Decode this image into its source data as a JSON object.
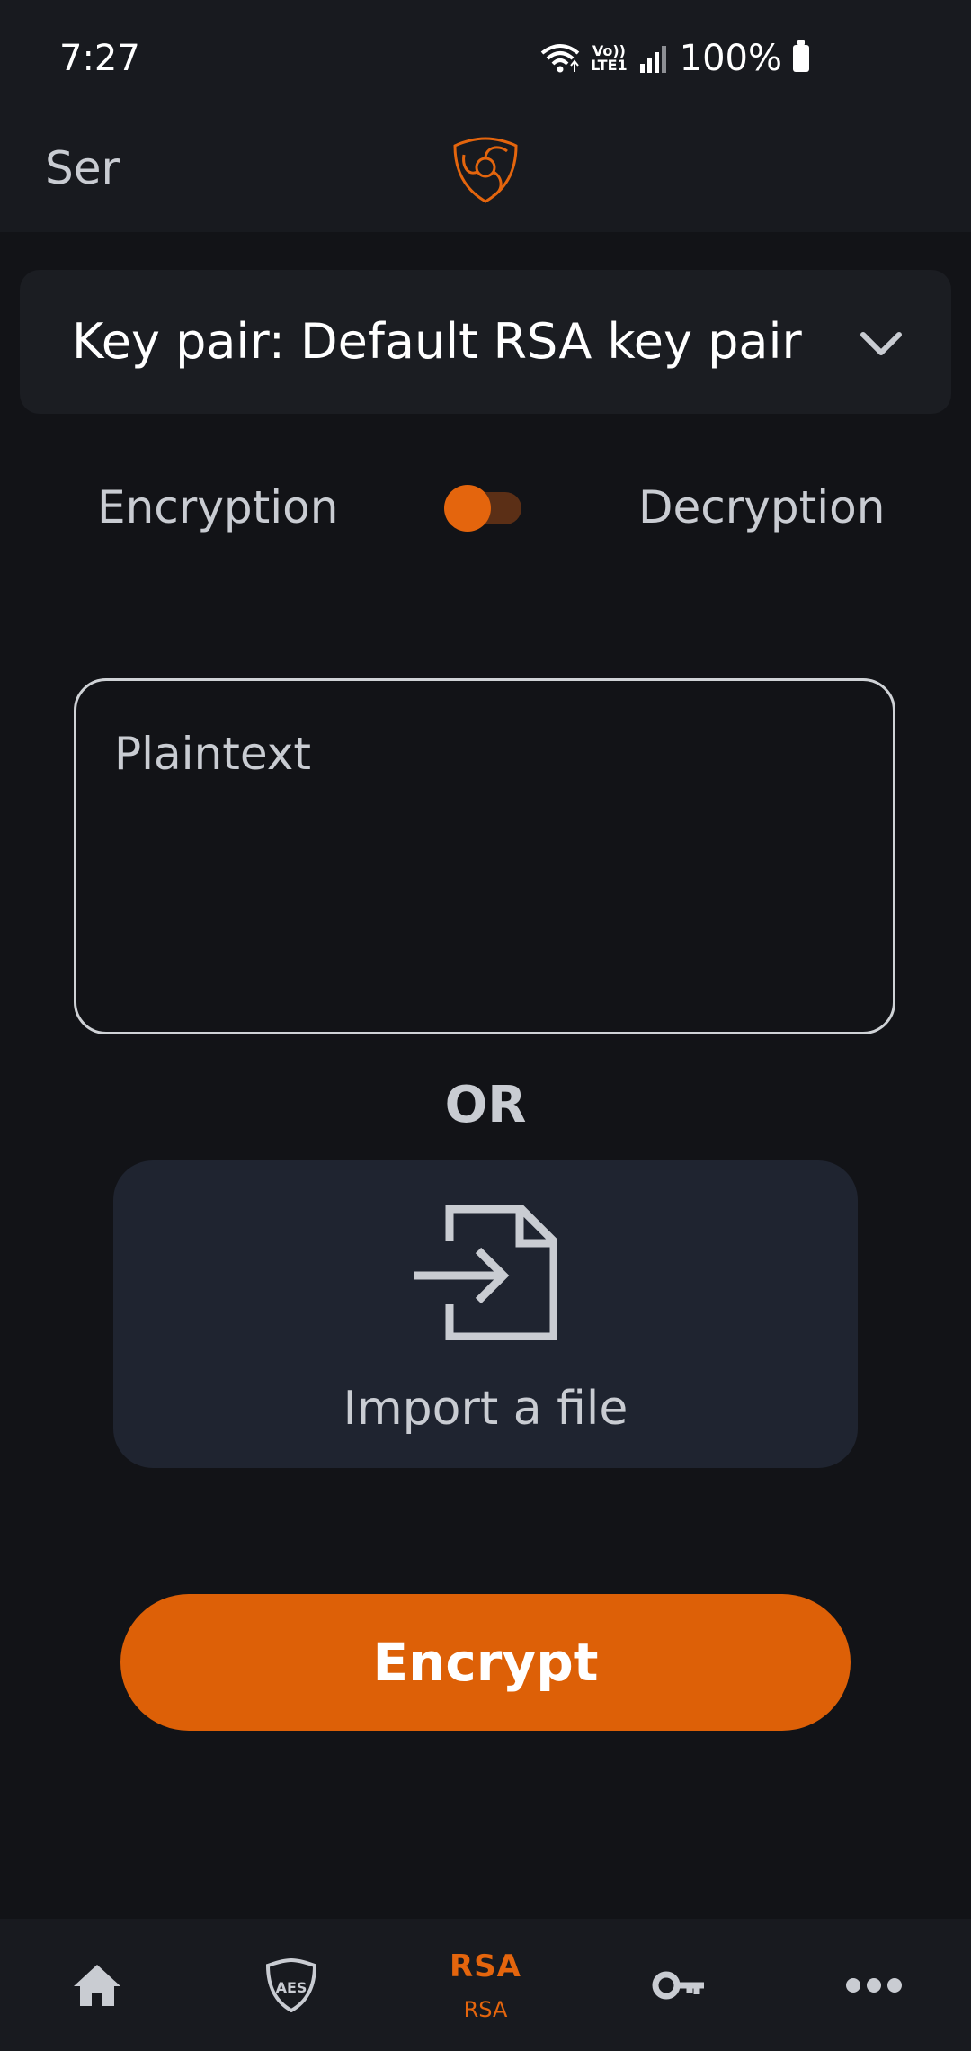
{
  "status_bar": {
    "time": "7:27",
    "network_top": "Vo))",
    "network_bottom": "LTE1",
    "battery_text": "100%"
  },
  "app_bar": {
    "title": "Ser",
    "logo_icon": "shield-swirl-logo"
  },
  "keypair": {
    "label": "Key pair: Default RSA key pair",
    "chevron_icon": "chevron-down-icon"
  },
  "mode": {
    "encryption_label": "Encryption",
    "decryption_label": "Decryption",
    "selected": "Encryption"
  },
  "plaintext": {
    "placeholder": "Plaintext",
    "value": ""
  },
  "or_label": "OR",
  "import": {
    "label": "Import a file",
    "icon": "file-import-icon"
  },
  "encrypt_button": {
    "label": "Encrypt"
  },
  "bottom_nav": {
    "items": [
      {
        "icon": "home-icon",
        "label": ""
      },
      {
        "icon": "aes-shield-icon",
        "label": "AES"
      },
      {
        "icon": "rsa-icon",
        "label": "RSA",
        "top_text": "RSA",
        "active": true
      },
      {
        "icon": "key-icon",
        "label": ""
      },
      {
        "icon": "more-icon",
        "label": ""
      }
    ]
  },
  "colors": {
    "accent": "#dd6007",
    "background": "#121317",
    "surface": "#1b1d22",
    "card": "#1f2430"
  }
}
